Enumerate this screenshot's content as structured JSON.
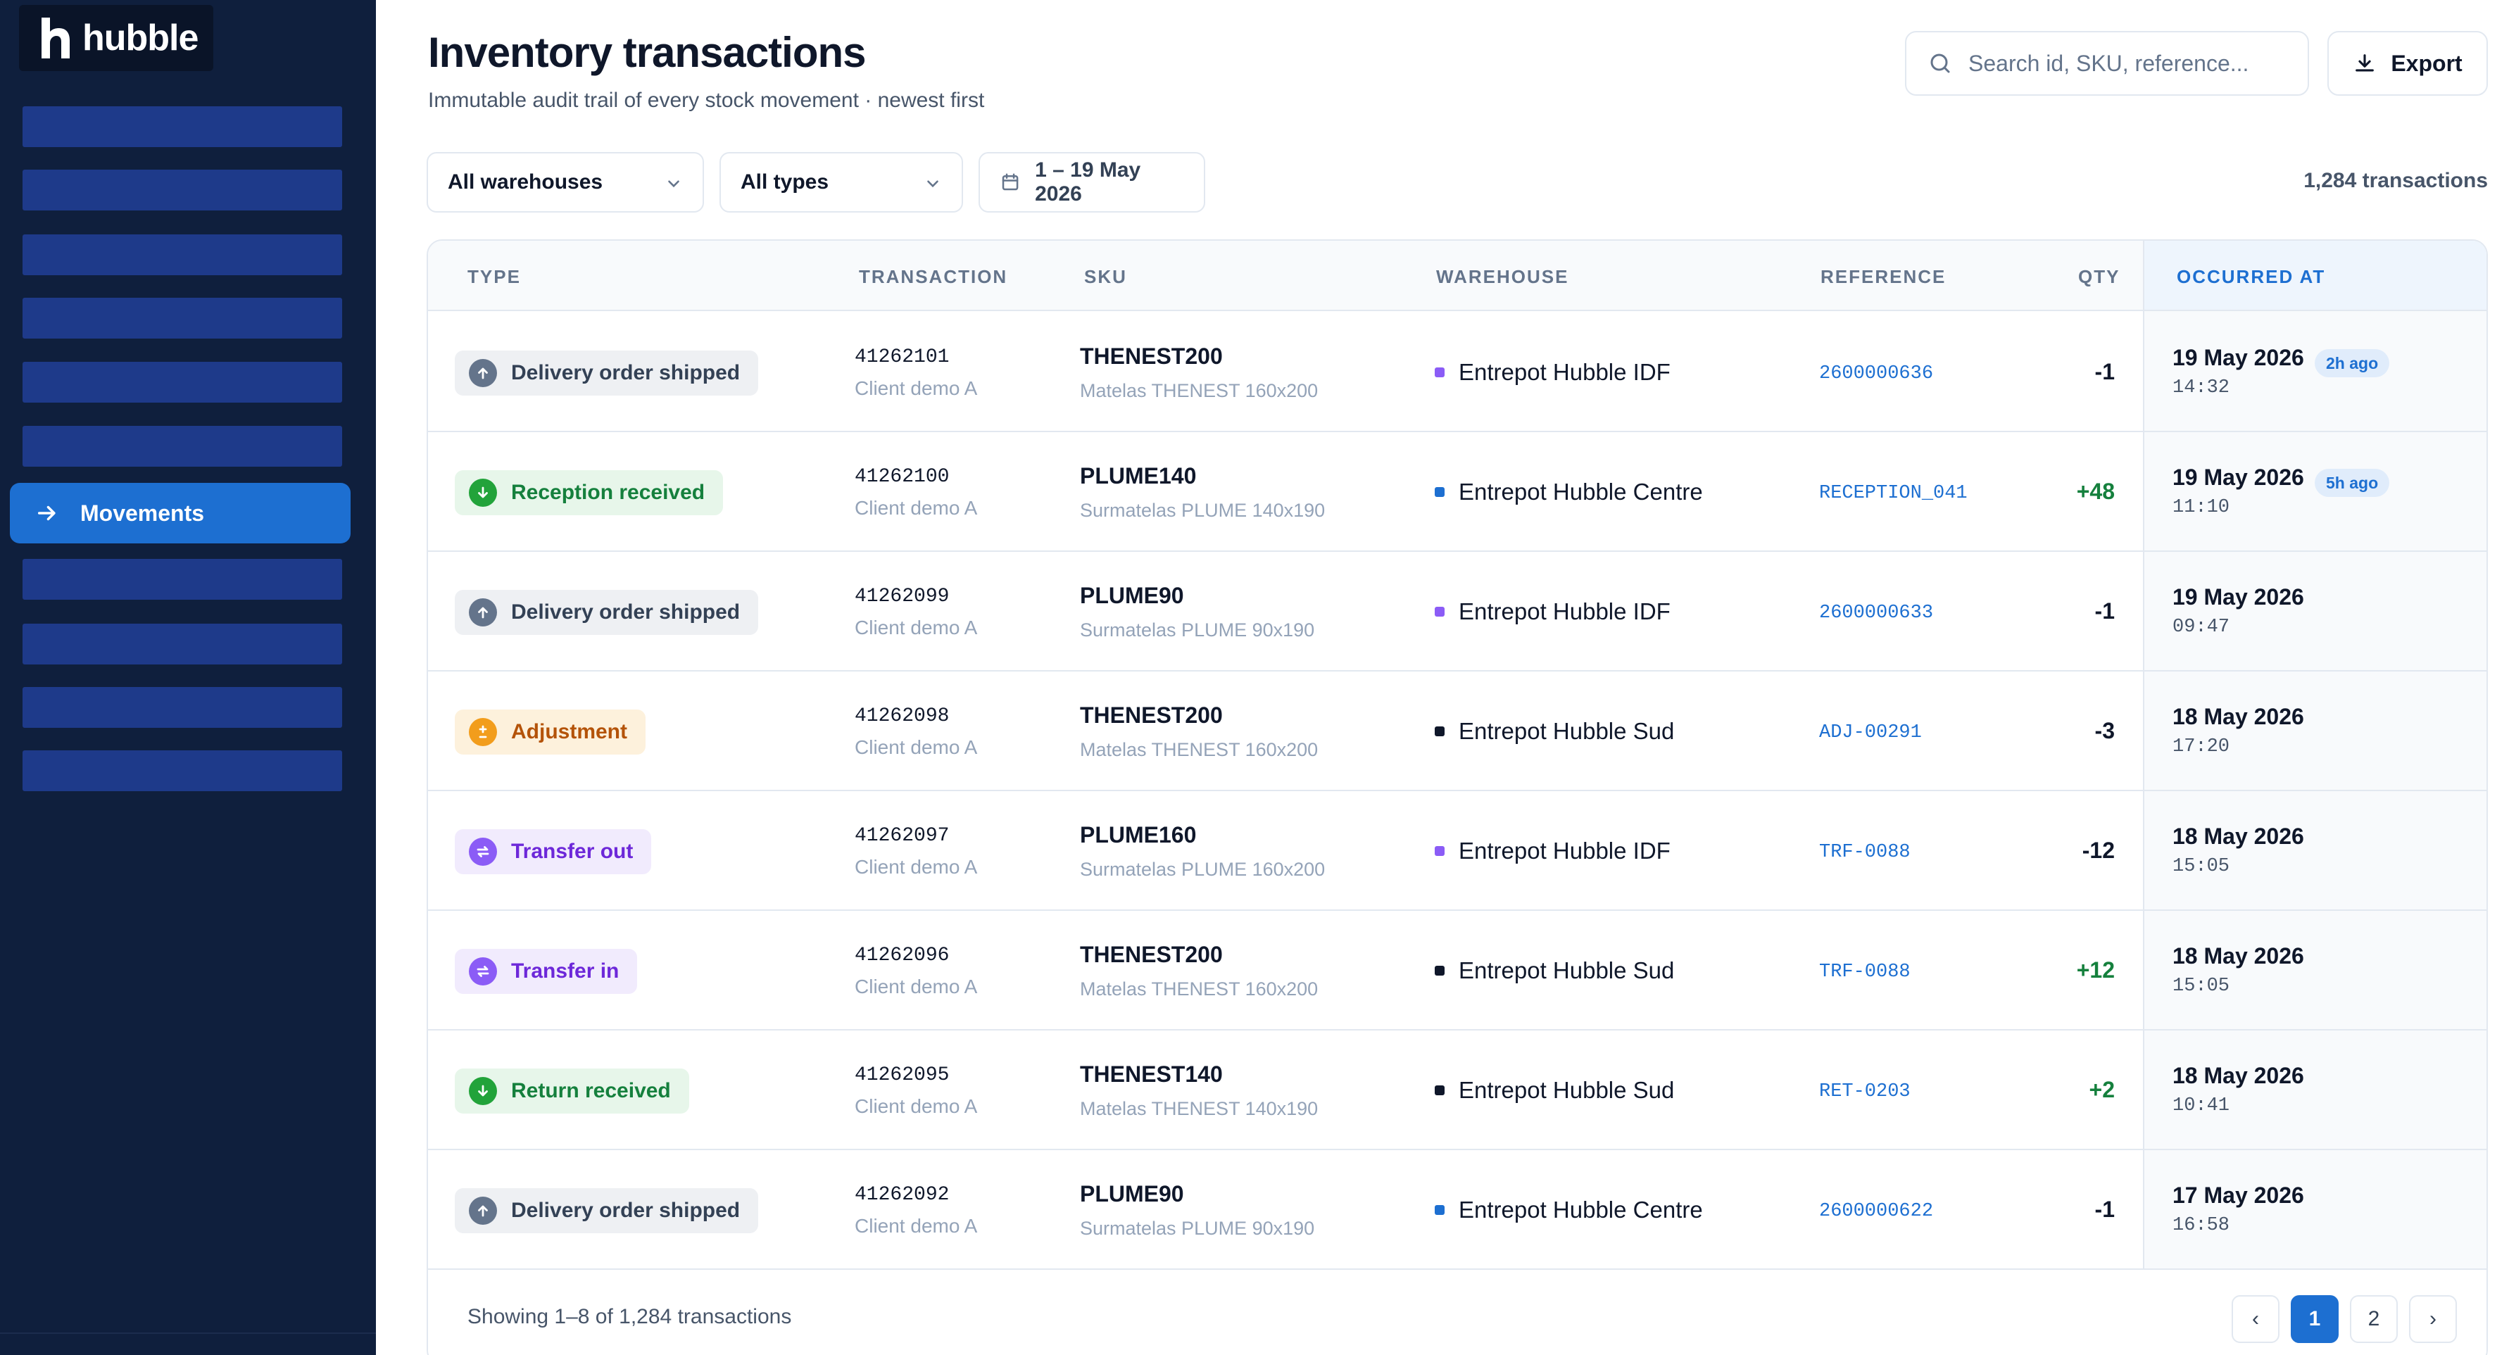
{
  "app": {
    "name": "hubble"
  },
  "sidebar": {
    "active_item": {
      "label": "Movements",
      "icon": "arrow-right-icon"
    }
  },
  "header": {
    "title": "Inventory transactions",
    "subtitle": "Immutable audit trail of every stock movement · newest first",
    "search_placeholder": "Search id, SKU, reference...",
    "export_label": "Export"
  },
  "filters": {
    "warehouse": "All warehouses",
    "type": "All types",
    "date_range": "1 – 19 May 2026",
    "count": "1,284 transactions"
  },
  "table": {
    "columns": {
      "type": "TYPE",
      "transaction": "TRANSACTION",
      "sku": "SKU",
      "warehouse": "WAREHOUSE",
      "reference": "REFERENCE",
      "qty": "QTY",
      "occurred_at": "OCCURRED AT"
    },
    "rows": [
      {
        "type": "Delivery order shipped",
        "type_kind": "shipped",
        "tx_id": "41262101",
        "client": "Client demo A",
        "sku": "THENEST200",
        "sku_name": "Matelas THENEST 160x200",
        "warehouse": "Entrepot Hubble IDF",
        "wh_color": "#8b5cf6",
        "reference": "2600000636",
        "qty": "-1",
        "date": "19 May 2026",
        "time": "14:32",
        "ago": "2h ago"
      },
      {
        "type": "Reception received",
        "type_kind": "received",
        "tx_id": "41262100",
        "client": "Client demo A",
        "sku": "PLUME140",
        "sku_name": "Surmatelas PLUME 140x190",
        "warehouse": "Entrepot Hubble Centre",
        "wh_color": "#1d6fd1",
        "reference": "RECEPTION_041",
        "qty": "+48",
        "date": "19 May 2026",
        "time": "11:10",
        "ago": "5h ago"
      },
      {
        "type": "Delivery order shipped",
        "type_kind": "shipped",
        "tx_id": "41262099",
        "client": "Client demo A",
        "sku": "PLUME90",
        "sku_name": "Surmatelas PLUME 90x190",
        "warehouse": "Entrepot Hubble IDF",
        "wh_color": "#8b5cf6",
        "reference": "2600000633",
        "qty": "-1",
        "date": "19 May 2026",
        "time": "09:47",
        "ago": ""
      },
      {
        "type": "Adjustment",
        "type_kind": "adjustment",
        "tx_id": "41262098",
        "client": "Client demo A",
        "sku": "THENEST200",
        "sku_name": "Matelas THENEST 160x200",
        "warehouse": "Entrepot Hubble Sud",
        "wh_color": "#0f172a",
        "reference": "ADJ-00291",
        "qty": "-3",
        "date": "18 May 2026",
        "time": "17:20",
        "ago": ""
      },
      {
        "type": "Transfer out",
        "type_kind": "transfer",
        "tx_id": "41262097",
        "client": "Client demo A",
        "sku": "PLUME160",
        "sku_name": "Surmatelas PLUME 160x200",
        "warehouse": "Entrepot Hubble IDF",
        "wh_color": "#8b5cf6",
        "reference": "TRF-0088",
        "qty": "-12",
        "date": "18 May 2026",
        "time": "15:05",
        "ago": ""
      },
      {
        "type": "Transfer in",
        "type_kind": "transfer",
        "tx_id": "41262096",
        "client": "Client demo A",
        "sku": "THENEST200",
        "sku_name": "Matelas THENEST 160x200",
        "warehouse": "Entrepot Hubble Sud",
        "wh_color": "#0f172a",
        "reference": "TRF-0088",
        "qty": "+12",
        "date": "18 May 2026",
        "time": "15:05",
        "ago": ""
      },
      {
        "type": "Return received",
        "type_kind": "received",
        "tx_id": "41262095",
        "client": "Client demo A",
        "sku": "THENEST140",
        "sku_name": "Matelas THENEST 140x190",
        "warehouse": "Entrepot Hubble Sud",
        "wh_color": "#0f172a",
        "reference": "RET-0203",
        "qty": "+2",
        "date": "18 May 2026",
        "time": "10:41",
        "ago": ""
      },
      {
        "type": "Delivery order shipped",
        "type_kind": "shipped",
        "tx_id": "41262092",
        "client": "Client demo A",
        "sku": "PLUME90",
        "sku_name": "Surmatelas PLUME 90x190",
        "warehouse": "Entrepot Hubble Centre",
        "wh_color": "#1d6fd1",
        "reference": "2600000622",
        "qty": "-1",
        "date": "17 May 2026",
        "time": "16:58",
        "ago": ""
      }
    ]
  },
  "footer": {
    "showing": "Showing 1–8 of 1,284 transactions",
    "prev_label": "‹",
    "next_label": "›",
    "pages": [
      "1",
      "2"
    ],
    "current_page": "1"
  },
  "badge_styles": {
    "shipped": {
      "bg": "#eef0f3",
      "fg": "#334155",
      "icon_bg": "#64748b",
      "icon": "arrow-up-icon"
    },
    "received": {
      "bg": "#e7f6ea",
      "fg": "#15803d",
      "icon_bg": "#22a33a",
      "icon": "arrow-down-icon"
    },
    "adjustment": {
      "bg": "#fdf1dc",
      "fg": "#b45309",
      "icon_bg": "#f29d1c",
      "icon": "plus-minus-icon"
    },
    "transfer": {
      "bg": "#f1ebfd",
      "fg": "#6d28d9",
      "icon_bg": "#8b5cf6",
      "icon": "swap-icon"
    }
  }
}
